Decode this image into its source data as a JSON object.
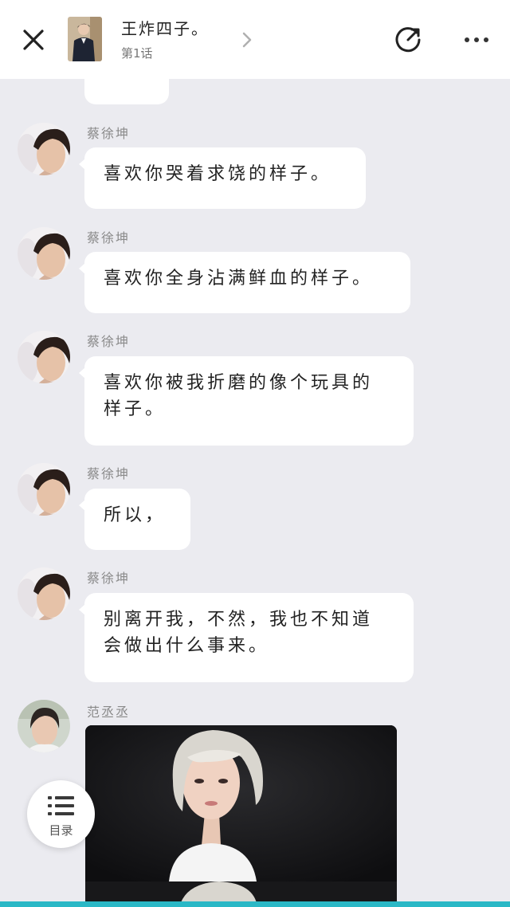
{
  "header": {
    "close_icon": "close-icon",
    "title": "王炸四子。",
    "subtitle": "第1话",
    "chevron_icon": "chevron-right-icon",
    "share_icon": "share-icon",
    "more_icon": "more-icon"
  },
  "messages": [
    {
      "sender": "蔡徐坤",
      "text": "喜欢你哭着求饶的样子。"
    },
    {
      "sender": "蔡徐坤",
      "text": "喜欢你全身沾满鲜血的样子。"
    },
    {
      "sender": "蔡徐坤",
      "text": "喜欢你被我折磨的像个玩具的样子。"
    },
    {
      "sender": "蔡徐坤",
      "text": "所以，"
    },
    {
      "sender": "蔡徐坤",
      "text": "别离开我，不然，我也不知道会做出什么事来。"
    },
    {
      "sender": "范丞丞",
      "text": ""
    }
  ],
  "toc": {
    "label": "目录",
    "icon": "list-icon"
  },
  "colors": {
    "background": "#ebebf0",
    "bubble": "#ffffff",
    "accent": "#2ab8c6"
  }
}
